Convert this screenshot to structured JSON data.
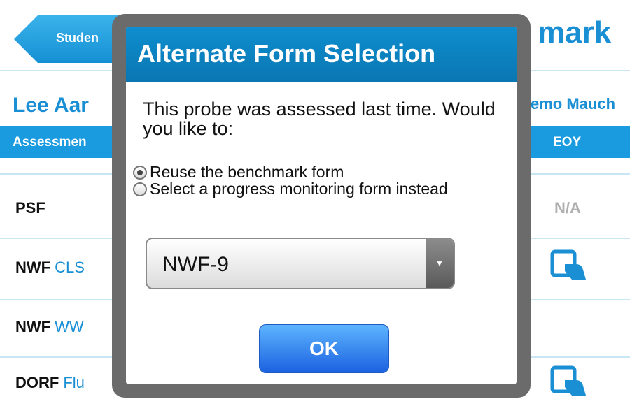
{
  "header": {
    "back_label": "Studen",
    "title_partial": "mark"
  },
  "student": {
    "name_partial": "Lee Aar",
    "assessor_partial": "emo Mauch"
  },
  "table": {
    "col_assessment": "Assessmen",
    "col_eoy": "EOY",
    "rows": [
      {
        "name": "PSF",
        "sub": "",
        "eoy": "N/A"
      },
      {
        "name": "NWF",
        "sub": "CLS",
        "eoy": "tap-icon"
      },
      {
        "name": "NWF",
        "sub": "WW",
        "eoy": ""
      },
      {
        "name": "DORF",
        "sub": "Flu",
        "eoy": "tap-icon"
      }
    ]
  },
  "dialog": {
    "title": "Alternate Form Selection",
    "prompt": "This probe was assessed last time. Would you like to:",
    "options": [
      {
        "label": "Reuse the benchmark form",
        "selected": true
      },
      {
        "label": "Select a progress monitoring form instead",
        "selected": false
      }
    ],
    "select_value": "NWF-9",
    "ok_label": "OK"
  },
  "colors": {
    "accent": "#1a9be0",
    "dialog_title_bar": "#0e8ecf",
    "ok_button": "#2b7cf0",
    "frame": "#6b6b6b"
  }
}
